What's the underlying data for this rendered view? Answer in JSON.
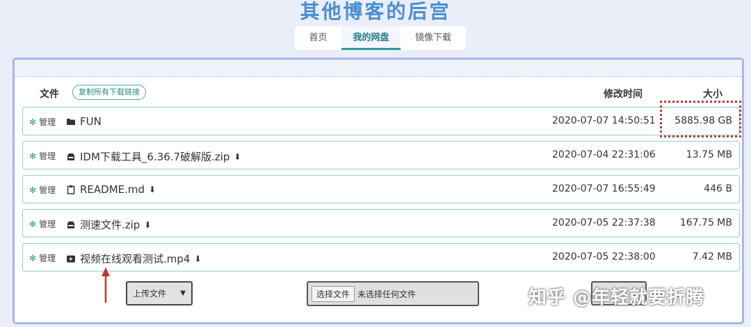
{
  "site": {
    "title": "其他博客的后宫"
  },
  "nav": {
    "tabs": [
      {
        "label": "首页"
      },
      {
        "label": "我的网盘"
      },
      {
        "label": "镜像下载"
      }
    ]
  },
  "table": {
    "col_file": "文件",
    "copy_button": "复制所有下载链接",
    "col_modified": "修改时间",
    "col_size": "大小",
    "manage_label": "管理",
    "rows": [
      {
        "name": "FUN",
        "icon": "folder-icon",
        "downloadable": false,
        "modified": "2020-07-07 14:50:51",
        "size": "5885.98 GB"
      },
      {
        "name": "IDM下载工具_6.36.7破解版.zip",
        "icon": "archive-icon",
        "downloadable": true,
        "modified": "2020-07-04 22:31:06",
        "size": "13.75 MB"
      },
      {
        "name": "README.md",
        "icon": "clipboard-icon",
        "downloadable": true,
        "modified": "2020-07-07 16:55:49",
        "size": "446 B"
      },
      {
        "name": "测速文件.zip",
        "icon": "archive-icon",
        "downloadable": true,
        "modified": "2020-07-05 22:37:38",
        "size": "167.75 MB"
      },
      {
        "name": "视频在线观看测试.mp4",
        "icon": "video-icon",
        "downloadable": true,
        "modified": "2020-07-05 22:38:00",
        "size": "7.42 MB"
      }
    ]
  },
  "upload": {
    "select_value": "上传文件",
    "choose_button": "选择文件",
    "no_file_text": "未选择任何文件"
  },
  "watermark": "知乎 @年轻就要折腾",
  "colors": {
    "accent": "#2a9d8f",
    "panel_border": "#a7b6ef",
    "highlight": "#c0392b",
    "title": "#4a8ed0"
  }
}
